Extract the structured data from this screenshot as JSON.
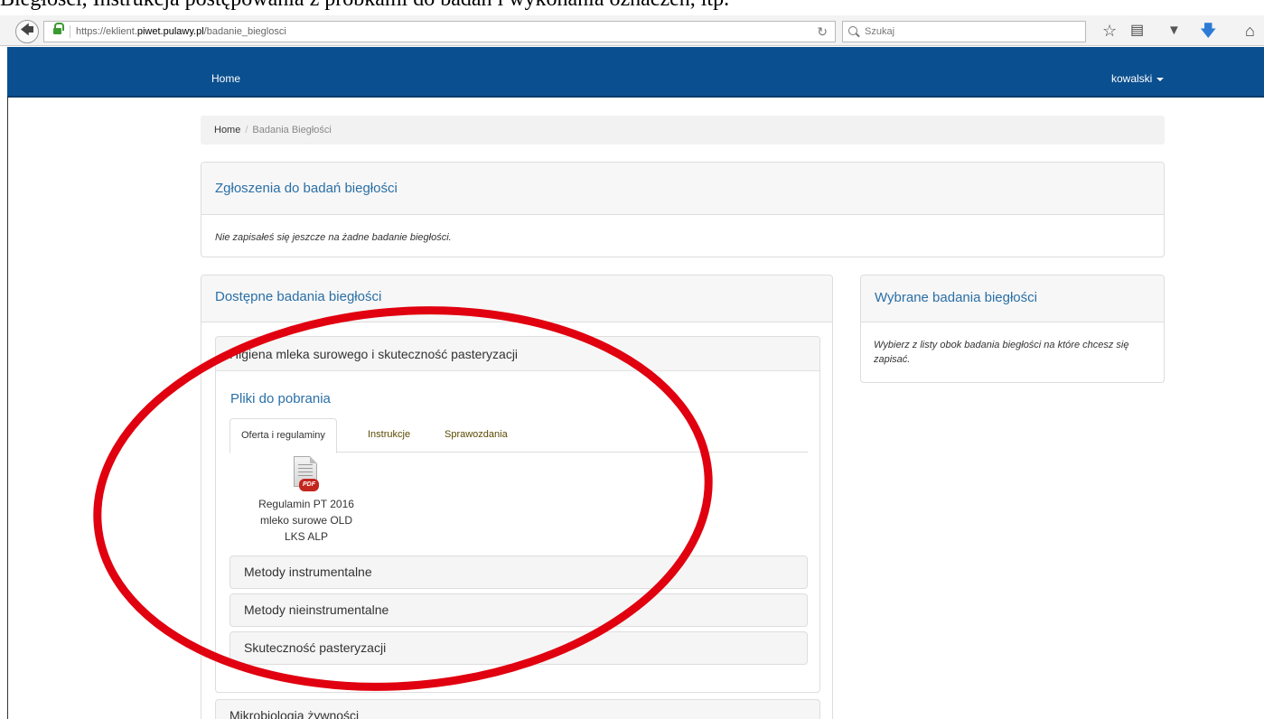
{
  "caption": "Biegłości, Instrukcja postępowania z próbkami do badań i wykonania oznaczeń, itp.",
  "browser": {
    "url_prefix": "https://eklient.",
    "url_domain": "piwet.pulawy.pl",
    "url_path": "/badanie_bieglosci",
    "search_placeholder": "Szukaj"
  },
  "nav": {
    "home": "Home",
    "user": "kowalski"
  },
  "breadcrumb": {
    "home": "Home",
    "separator": "/",
    "current": "Badania Biegłości"
  },
  "registrations_panel": {
    "title": "Zgłoszenia do badań biegłości",
    "message": "Nie zapisałeś się jeszcze na żadne badanie biegłości."
  },
  "available_panel": {
    "title": "Dostępne badania biegłości",
    "group": {
      "title": "Higiena mleka surowego i skuteczność pasteryzacji",
      "files_title": "Pliki do pobrania",
      "tabs": [
        "Oferta i regulaminy",
        "Instrukcje",
        "Sprawozdania"
      ],
      "file": {
        "badge": "PDF",
        "label": "Regulamin PT 2016 mleko surowe OLD LKS ALP"
      },
      "subitems": [
        "Metody instrumentalne",
        "Metody nieinstrumentalne",
        "Skuteczność pasteryzacji"
      ]
    },
    "next_group": "Mikrobiologia żywności"
  },
  "selected_panel": {
    "title": "Wybrane badania biegłości",
    "message": "Wybierz z listy obok badania biegłości na które chcesz się zapisać."
  },
  "colors": {
    "navbar": "#0a4f8f",
    "panel_title": "#2a6fa6",
    "annotation": "#e0000f"
  }
}
